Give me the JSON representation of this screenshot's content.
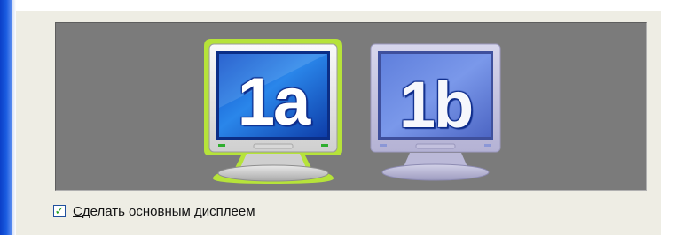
{
  "monitors": [
    {
      "label": "1a",
      "selected": true,
      "state": "primary"
    },
    {
      "label": "1b",
      "selected": false,
      "state": "secondary"
    }
  ],
  "checkbox": {
    "checked": true,
    "mnemonic": "С",
    "label_rest": "делать основным дисплеем"
  },
  "colors": {
    "stage_bg": "#7b7b7b",
    "selection_outline": "#b6e33a",
    "screen_blue": "#1a6fe0",
    "screen_inactive": "#6e86d8",
    "checkmark": "#21a121"
  },
  "icons": {
    "checkmark": "check-icon"
  }
}
